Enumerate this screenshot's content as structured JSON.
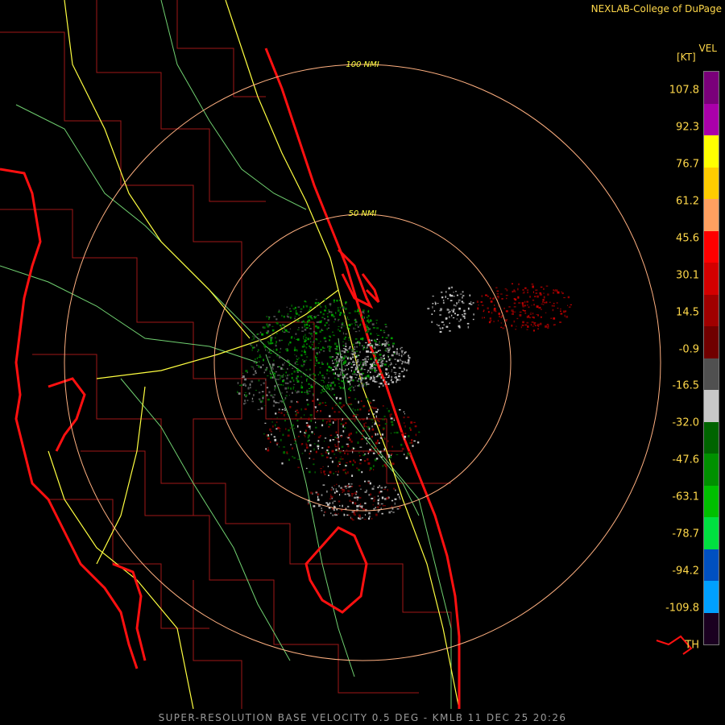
{
  "header": {
    "credit": "NEXLAB-College of DuPage"
  },
  "footer": {
    "caption": "SUPER-RESOLUTION BASE VELOCITY 0.5 DEG - KMLB 11 DEC 25 20:26"
  },
  "map": {
    "rings": [
      {
        "label": "50 NMI"
      },
      {
        "label": "100 NMI"
      }
    ]
  },
  "legend": {
    "product": "VEL",
    "unit": "[KT]",
    "labels": [
      "107.8",
      "92.3",
      "76.7",
      "61.2",
      "45.6",
      "30.1",
      "14.5",
      "-0.9",
      "-16.5",
      "-32.0",
      "-47.6",
      "-63.1",
      "-78.7",
      "-94.2",
      "-109.8",
      "TH"
    ],
    "colors": [
      "#7a007a",
      "#aa00aa",
      "#ffff00",
      "#ffcc00",
      "#ffa060",
      "#ff0000",
      "#d40000",
      "#a00000",
      "#700000",
      "#505050",
      "#c8c8c8",
      "#006400",
      "#009000",
      "#00c000",
      "#00e040",
      "#0050c0",
      "#00a0ff",
      "#1a0020"
    ]
  },
  "colors": {
    "coast": "#ff1010",
    "county": "#b01818",
    "highway": "#ffff40",
    "road": "#80e080",
    "ring": "#ffb080",
    "ring_label": "#ffff40"
  }
}
